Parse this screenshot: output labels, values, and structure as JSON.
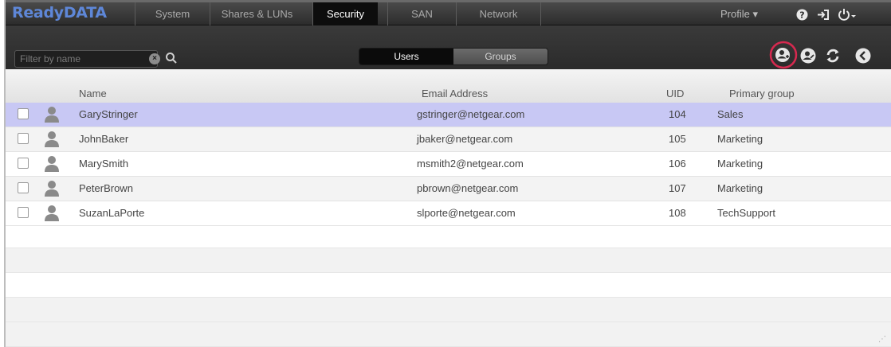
{
  "app": {
    "logo": "ReadyDATA"
  },
  "nav": {
    "tabs": [
      {
        "label": "System",
        "active": false
      },
      {
        "label": "Shares & LUNs",
        "active": false
      },
      {
        "label": "Security",
        "active": true
      },
      {
        "label": "SAN",
        "active": false
      },
      {
        "label": "Network",
        "active": false
      }
    ],
    "profile_label": "Profile ▾"
  },
  "toolbar": {
    "filter_placeholder": "Filter by name",
    "segments": {
      "users": "Users",
      "groups": "Groups"
    },
    "active_segment": "users",
    "icons": [
      "add-user-icon",
      "edit-user-icon",
      "refresh-icon",
      "back-icon"
    ]
  },
  "grid": {
    "columns": {
      "name": "Name",
      "email": "Email Address",
      "uid": "UID",
      "group": "Primary group"
    },
    "rows": [
      {
        "name": "GaryStringer",
        "email": "gstringer@netgear.com",
        "uid": "104",
        "group": "Sales",
        "selected": true
      },
      {
        "name": "JohnBaker",
        "email": "jbaker@netgear.com",
        "uid": "105",
        "group": "Marketing",
        "selected": false
      },
      {
        "name": "MarySmith",
        "email": "msmith2@netgear.com",
        "uid": "106",
        "group": "Marketing",
        "selected": false
      },
      {
        "name": "PeterBrown",
        "email": "pbrown@netgear.com",
        "uid": "107",
        "group": "Marketing",
        "selected": false
      },
      {
        "name": "SuzanLaPorte",
        "email": "slporte@netgear.com",
        "uid": "108",
        "group": "TechSupport",
        "selected": false
      }
    ]
  },
  "colors": {
    "logo": "#5e87d8",
    "selected_row": "#c8c8f4",
    "highlight_ring": "#d6294f"
  }
}
